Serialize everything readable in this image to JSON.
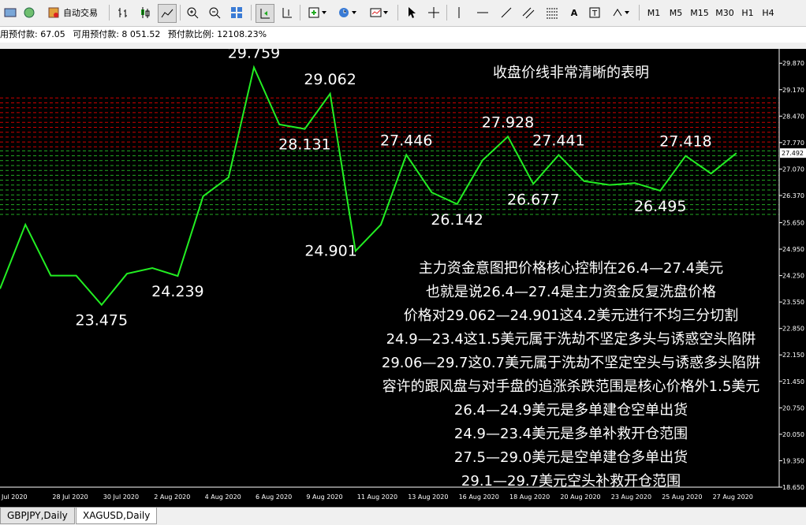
{
  "toolbar": {
    "autotrade_label": "自动交易",
    "timeframes": [
      "M1",
      "M5",
      "M15",
      "M30",
      "H1",
      "H4"
    ]
  },
  "status": {
    "used_margin": "用预付款: 67.05",
    "free_margin": "可用预付款: 8 051.52",
    "margin_level": "预付款比例: 12108.23%"
  },
  "tabs": [
    {
      "label": "GBPJPY,Daily",
      "active": false
    },
    {
      "label": "XAGUSD,Daily",
      "active": true
    }
  ],
  "colors": {
    "background": "#000000",
    "line": "#22ee22",
    "resistance_band": "#cc0000",
    "support_band": "#22aa22",
    "text": "#ffffff",
    "axis": "#ffffff"
  },
  "chart_data": {
    "type": "line",
    "symbol": "XAGUSD",
    "timeframe": "Daily",
    "title": "收盘价线非常清晰的表明",
    "x_labels": [
      "Jul 2020",
      "28 Jul 2020",
      "30 Jul 2020",
      "2 Aug 2020",
      "4 Aug 2020",
      "6 Aug 2020",
      "9 Aug 2020",
      "11 Aug 2020",
      "13 Aug 2020",
      "16 Aug 2020",
      "18 Aug 2020",
      "20 Aug 2020",
      "23 Aug 2020",
      "25 Aug 2020",
      "27 Aug 2020"
    ],
    "y_ticks": [
      "29.870",
      "29.170",
      "28.470",
      "27.770",
      "27.070",
      "26.370",
      "25.650",
      "24.950",
      "24.250",
      "23.550",
      "22.850",
      "22.150",
      "21.450",
      "20.750",
      "20.050",
      "19.350",
      "18.650"
    ],
    "ylim": [
      18.65,
      30.25
    ],
    "current_price": "27.492",
    "closes": [
      23.9,
      25.6,
      24.25,
      24.25,
      23.475,
      24.3,
      24.45,
      24.239,
      26.35,
      26.85,
      29.759,
      28.25,
      28.131,
      29.062,
      24.901,
      25.6,
      27.446,
      26.45,
      26.142,
      27.3,
      27.928,
      26.677,
      27.441,
      26.75,
      26.65,
      26.7,
      26.495,
      27.418,
      26.95,
      27.492
    ],
    "price_labels": [
      {
        "text": "29.759",
        "index": 10,
        "value": 29.759,
        "pos": "above"
      },
      {
        "text": "29.062",
        "index": 13,
        "value": 29.062,
        "pos": "above"
      },
      {
        "text": "28.131",
        "index": 12,
        "value": 28.131,
        "pos": "below"
      },
      {
        "text": "27.928",
        "index": 20,
        "value": 27.928,
        "pos": "above"
      },
      {
        "text": "27.446",
        "index": 16,
        "value": 27.446,
        "pos": "above"
      },
      {
        "text": "27.441",
        "index": 22,
        "value": 27.441,
        "pos": "above"
      },
      {
        "text": "27.418",
        "index": 27,
        "value": 27.418,
        "pos": "above"
      },
      {
        "text": "26.677",
        "index": 21,
        "value": 26.677,
        "pos": "below"
      },
      {
        "text": "26.495",
        "index": 26,
        "value": 26.495,
        "pos": "below"
      },
      {
        "text": "26.142",
        "index": 18,
        "value": 26.142,
        "pos": "below"
      },
      {
        "text": "24.901",
        "index": 14,
        "value": 24.901,
        "pos": "left"
      },
      {
        "text": "24.239",
        "index": 7,
        "value": 24.239,
        "pos": "below"
      },
      {
        "text": "23.475",
        "index": 4,
        "value": 23.475,
        "pos": "below"
      }
    ],
    "bands": [
      {
        "name": "resistance",
        "low": 27.55,
        "high": 28.95,
        "color": "#cc0000"
      },
      {
        "name": "support",
        "low": 25.75,
        "high": 27.55,
        "color": "#22aa22"
      }
    ],
    "annotations": [
      "主力资金意图把价格核心控制在26.4—27.4美元",
      "也就是说26.4—27.4是主力资金反复洗盘价格",
      "价格对29.062—24.901这4.2美元进行不均三分切割",
      "24.9—23.4这1.5美元属于洗劫不坚定多头与诱惑空头陷阱",
      "29.06—29.7这0.7美元属于洗劫不坚定空头与诱惑多头陷阱",
      "容许的跟风盘与对手盘的追涨杀跌范围是核心价格外1.5美元",
      "26.4—24.9美元是多单建仓空单出货",
      "24.9—23.4美元是多单补救开仓范围",
      "27.5—29.0美元是空单建仓多单出货",
      "29.1—29.7美元空头补救开仓范围"
    ]
  }
}
